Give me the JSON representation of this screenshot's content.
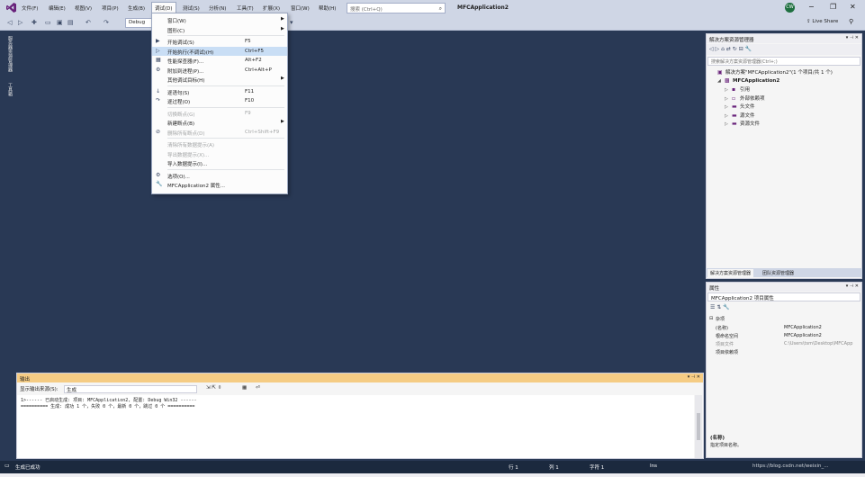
{
  "title_bar": {
    "menus": [
      "文件(F)",
      "编辑(E)",
      "视图(V)",
      "项目(P)",
      "生成(B)",
      "调试(D)",
      "测试(S)",
      "分析(N)",
      "工具(T)",
      "扩展(X)",
      "窗口(W)",
      "帮助(H)"
    ],
    "search_placeholder": "搜索 (Ctrl+Q)",
    "app_title": "MFCApplication2",
    "avatar_initials": "CW",
    "live_share": "Live Share"
  },
  "toolbar": {
    "config": "Debug"
  },
  "left_tabs": [
    "服务器资源管理器",
    "工具箱"
  ],
  "debug_menu": {
    "items": [
      {
        "label": "窗口(W)",
        "shortcut": "",
        "submenu": true,
        "icon": "",
        "disabled": false
      },
      {
        "label": "图形(C)",
        "shortcut": "",
        "submenu": true,
        "icon": "",
        "disabled": false
      },
      {
        "sep": true
      },
      {
        "label": "开始调试(S)",
        "shortcut": "F5",
        "icon": "▶",
        "disabled": false
      },
      {
        "label": "开始执行(不调试)(H)",
        "shortcut": "Ctrl+F5",
        "icon": "▷",
        "highlight": true,
        "disabled": false
      },
      {
        "label": "性能探查器(F)...",
        "shortcut": "Alt+F2",
        "icon": "▦",
        "disabled": false
      },
      {
        "label": "附加到进程(P)...",
        "shortcut": "Ctrl+Alt+P",
        "icon": "⚙",
        "disabled": false
      },
      {
        "label": "其他调试目标(H)",
        "shortcut": "",
        "submenu": true,
        "icon": "",
        "disabled": false
      },
      {
        "sep": true
      },
      {
        "label": "逐语句(S)",
        "shortcut": "F11",
        "icon": "↓",
        "disabled": false
      },
      {
        "label": "逐过程(O)",
        "shortcut": "F10",
        "icon": "↷",
        "disabled": false
      },
      {
        "sep": true
      },
      {
        "label": "切换断点(G)",
        "shortcut": "F9",
        "icon": "",
        "disabled": true
      },
      {
        "label": "新建断点(B)",
        "shortcut": "",
        "submenu": true,
        "icon": "",
        "disabled": false
      },
      {
        "label": "删除所有断点(D)",
        "shortcut": "Ctrl+Shift+F9",
        "icon": "⊘",
        "disabled": true
      },
      {
        "sep": true
      },
      {
        "label": "清除所有数据提示(A)",
        "shortcut": "",
        "icon": "",
        "disabled": true
      },
      {
        "label": "导出数据提示(X)...",
        "shortcut": "",
        "icon": "",
        "disabled": true
      },
      {
        "label": "导入数据提示(I)...",
        "shortcut": "",
        "icon": "",
        "disabled": false
      },
      {
        "sep": true
      },
      {
        "label": "选项(O)...",
        "shortcut": "",
        "icon": "⚙",
        "disabled": false
      },
      {
        "label": "MFCApplication2 属性...",
        "shortcut": "",
        "icon": "🔧",
        "disabled": false
      }
    ]
  },
  "solution_explorer": {
    "title": "解决方案资源管理器",
    "search_placeholder": "搜索解决方案资源管理器(Ctrl+;)",
    "tree": [
      {
        "label": "解决方案\"MFCApplication2\"(1 个项目/共 1 个)",
        "indent": 0,
        "arrow": "",
        "icon": "▣"
      },
      {
        "label": "MFCApplication2",
        "indent": 1,
        "arrow": "◢",
        "icon": "▩",
        "bold": true
      },
      {
        "label": "引用",
        "indent": 2,
        "arrow": "▷",
        "icon": "▪"
      },
      {
        "label": "外部依赖项",
        "indent": 2,
        "arrow": "▷",
        "icon": "▫"
      },
      {
        "label": "头文件",
        "indent": 2,
        "arrow": "▷",
        "icon": "▬"
      },
      {
        "label": "源文件",
        "indent": 2,
        "arrow": "▷",
        "icon": "▬"
      },
      {
        "label": "资源文件",
        "indent": 2,
        "arrow": "▷",
        "icon": "▬"
      }
    ],
    "tabs": [
      "解决方案资源管理器",
      "团队资源管理器"
    ]
  },
  "properties": {
    "title": "属性",
    "object": "MFCApplication2 项目属性",
    "category": "杂项",
    "rows": [
      {
        "name": "(名称)",
        "value": "MFCApplication2",
        "dim": false
      },
      {
        "name": "根命名空间",
        "value": "MFCApplication2",
        "dim": false
      },
      {
        "name": "项目文件",
        "value": "C:\\Users\\tsm\\Desktop\\MFCApp",
        "dim": true
      },
      {
        "name": "项目依赖项",
        "value": "",
        "dim": false
      }
    ],
    "desc_title": "(名称)",
    "desc": "指定项目名称。"
  },
  "output": {
    "title": "输出",
    "source_label": "显示输出来源(S):",
    "source_value": "生成",
    "lines": [
      "1>------ 已启动生成: 项目: MFCApplication2, 配置: Debug Win32 ------",
      "========== 生成: 成功 1 个，失败 0 个，最新 0 个，跳过 0 个 =========="
    ]
  },
  "status_bar": {
    "ready": "生成已成功",
    "row": "行 1",
    "col": "列 1",
    "ch": "字符 1",
    "ins": "Ins",
    "watermark": "https://blog.csdn.net/weixin_..."
  }
}
